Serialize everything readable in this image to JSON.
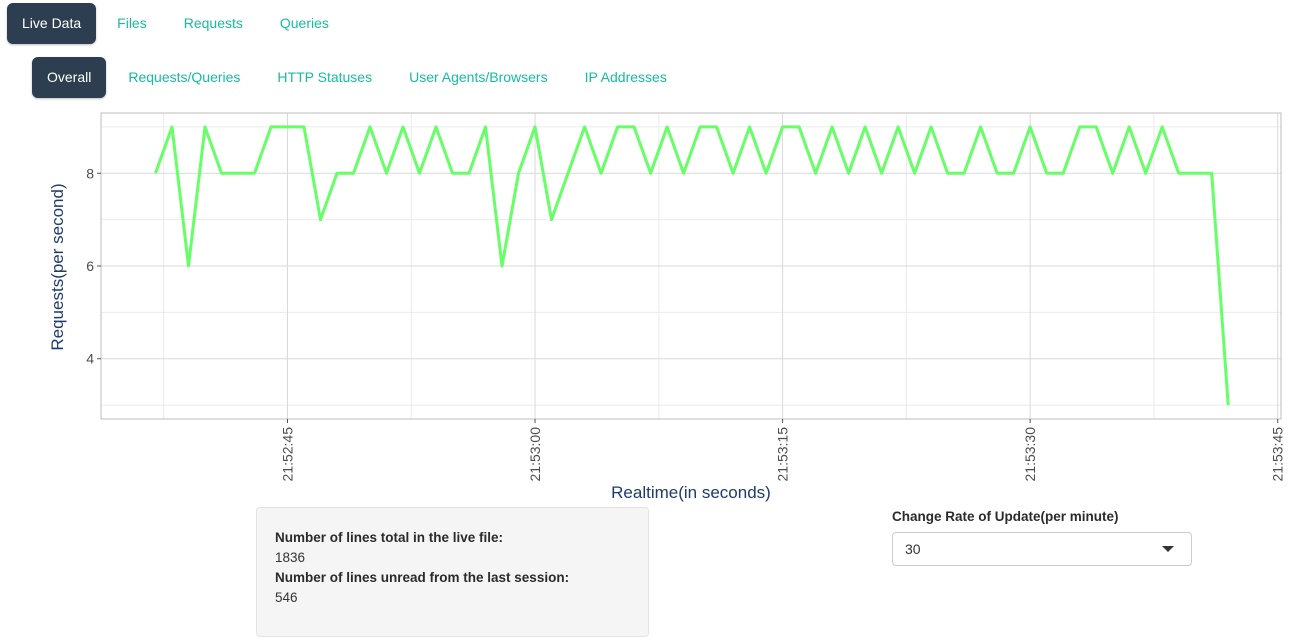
{
  "nav": {
    "main_tabs": [
      {
        "label": "Live Data",
        "active": true
      },
      {
        "label": "Files",
        "active": false
      },
      {
        "label": "Requests",
        "active": false
      },
      {
        "label": "Queries",
        "active": false
      }
    ],
    "sub_tabs": [
      {
        "label": "Overall",
        "active": true
      },
      {
        "label": "Requests/Queries",
        "active": false
      },
      {
        "label": "HTTP Statuses",
        "active": false
      },
      {
        "label": "User Agents/Browsers",
        "active": false
      },
      {
        "label": "IP Addresses",
        "active": false
      }
    ]
  },
  "chart_data": {
    "type": "line",
    "title": "",
    "xlabel": "Realtime(in seconds)",
    "ylabel": "Requests(per second)",
    "x_ticks": [
      "21:52:45",
      "21:53:00",
      "21:53:15",
      "21:53:30",
      "21:53:45"
    ],
    "y_ticks": [
      4,
      6,
      8
    ],
    "ylim": [
      2.7,
      9.3
    ],
    "xlim": [
      "21:52:33.7",
      "21:53:45.2"
    ],
    "grid": true,
    "line_color": "#66ff66",
    "series": [
      {
        "x": [
          "21:52:37",
          "21:52:38",
          "21:52:39",
          "21:52:40",
          "21:52:41",
          "21:52:42",
          "21:52:43",
          "21:52:44",
          "21:52:45",
          "21:52:46",
          "21:52:47",
          "21:52:48",
          "21:52:49",
          "21:52:50",
          "21:52:51",
          "21:52:52",
          "21:52:53",
          "21:52:54",
          "21:52:55",
          "21:52:56",
          "21:52:57",
          "21:52:58",
          "21:52:59",
          "21:53:00",
          "21:53:01",
          "21:53:02",
          "21:53:03",
          "21:53:04",
          "21:53:05",
          "21:53:06",
          "21:53:07",
          "21:53:08",
          "21:53:09",
          "21:53:10",
          "21:53:11",
          "21:53:12",
          "21:53:13",
          "21:53:14",
          "21:53:15",
          "21:53:16",
          "21:53:17",
          "21:53:18",
          "21:53:19",
          "21:53:20",
          "21:53:21",
          "21:53:22",
          "21:53:23",
          "21:53:24",
          "21:53:25",
          "21:53:26",
          "21:53:27",
          "21:53:28",
          "21:53:29",
          "21:53:30",
          "21:53:31",
          "21:53:32",
          "21:53:33",
          "21:53:34",
          "21:53:35",
          "21:53:36",
          "21:53:37",
          "21:53:38",
          "21:53:39",
          "21:53:40",
          "21:53:41",
          "21:53:42"
        ],
        "values": [
          8,
          9,
          6,
          9,
          8,
          8,
          8,
          9,
          9,
          9,
          7,
          8,
          8,
          9,
          8,
          9,
          8,
          9,
          8,
          8,
          9,
          6,
          8,
          9,
          7,
          8,
          9,
          8,
          9,
          9,
          8,
          9,
          8,
          9,
          9,
          8,
          9,
          8,
          9,
          9,
          8,
          9,
          8,
          9,
          8,
          9,
          8,
          9,
          8,
          8,
          9,
          8,
          8,
          9,
          8,
          8,
          9,
          9,
          8,
          9,
          8,
          9,
          8,
          8,
          8,
          3
        ]
      }
    ]
  },
  "info": {
    "total_label": "Number of lines total in the live file:",
    "total_value": "1836",
    "unread_label": "Number of lines unread from the last session:",
    "unread_value": "546"
  },
  "rate": {
    "label": "Change Rate of Update(per minute)",
    "selected": "30",
    "icon": "chevron-down-icon"
  }
}
